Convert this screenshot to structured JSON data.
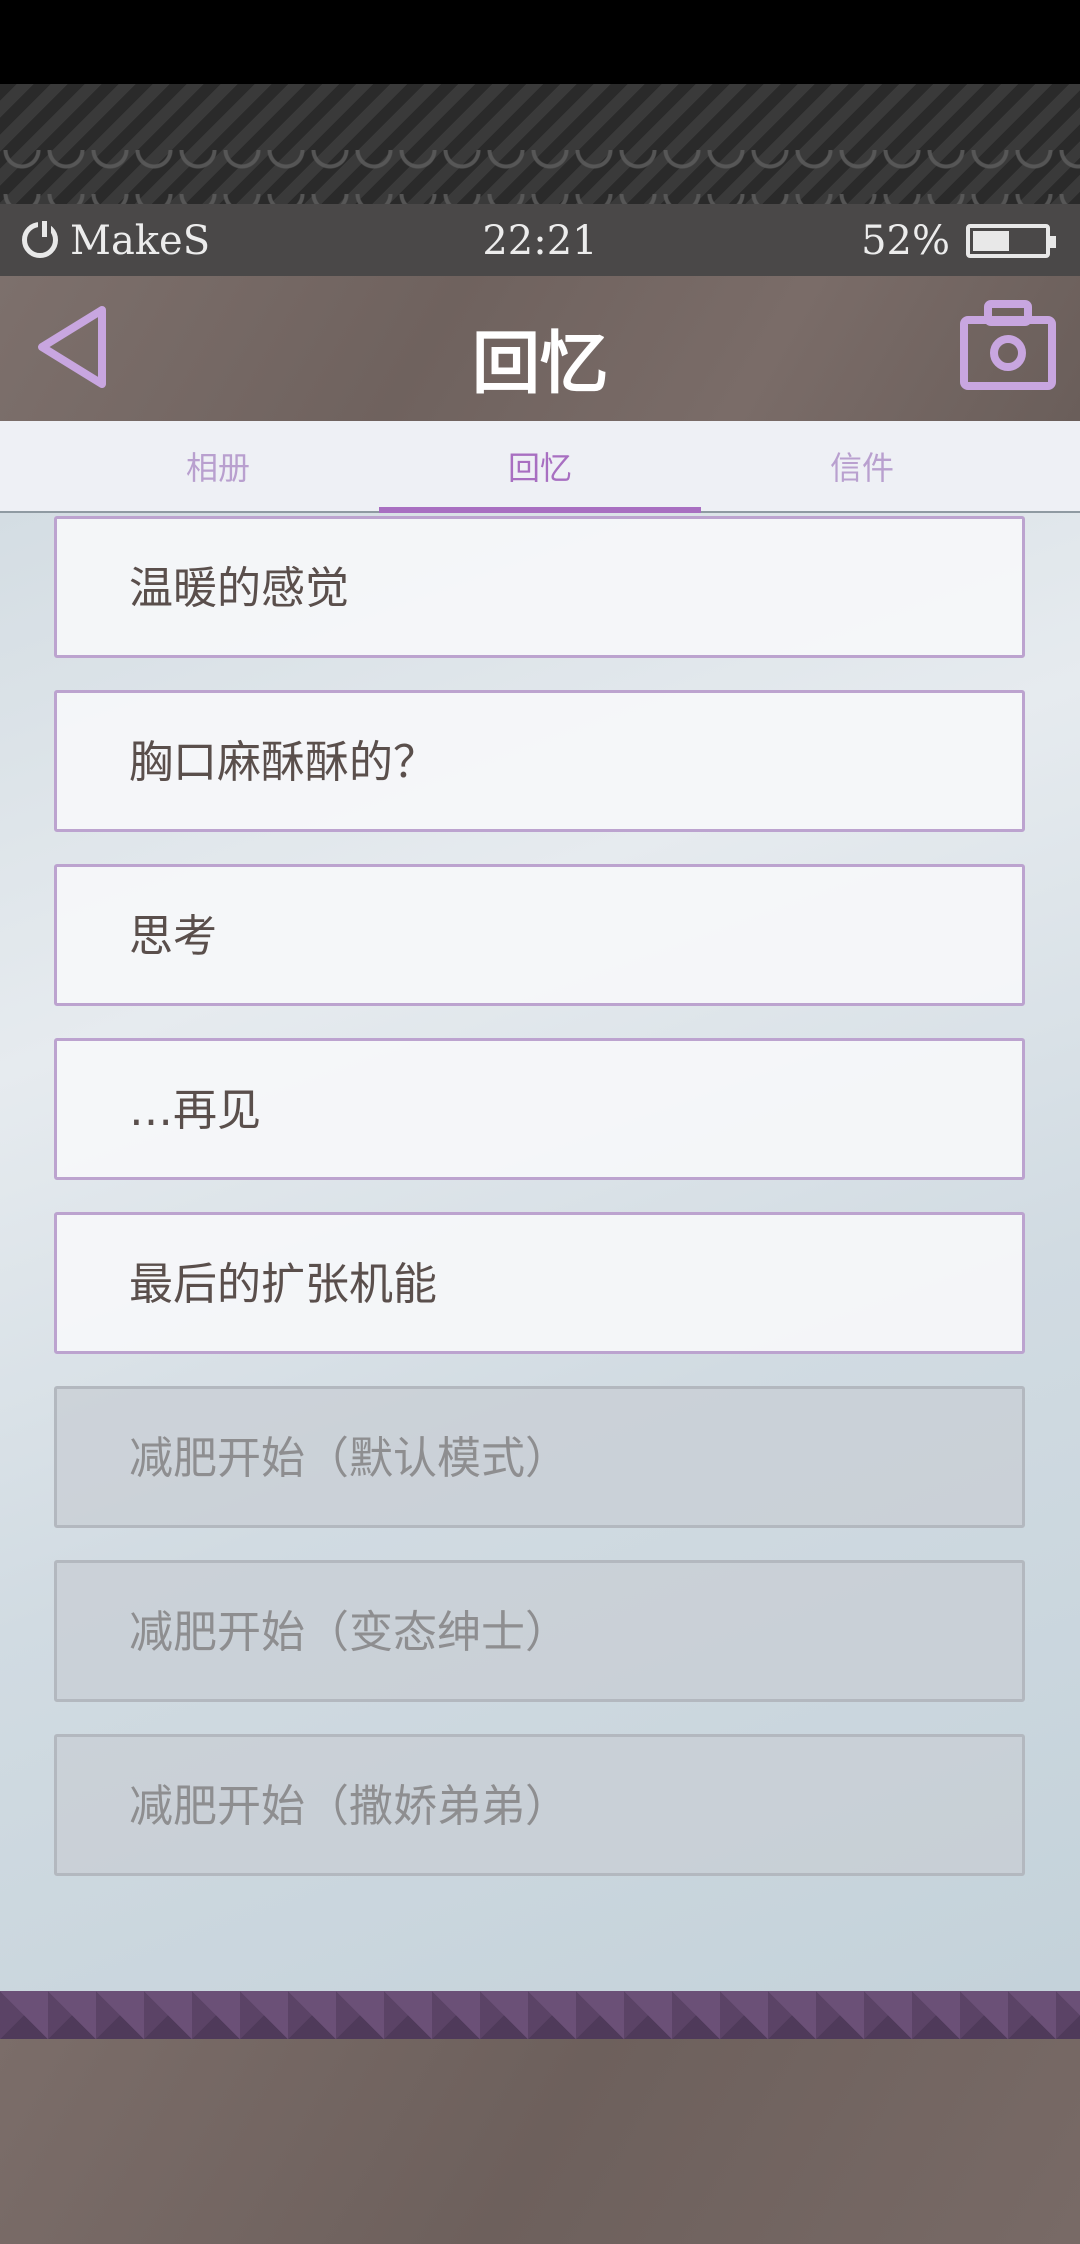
{
  "status_bar": {
    "carrier": "MakeS",
    "time": "22:21",
    "battery_percent": "52%",
    "battery_level": 0.52
  },
  "header": {
    "title": "回忆",
    "back_icon": "back-triangle-icon",
    "camera_icon": "camera-icon"
  },
  "tabs": [
    {
      "label": "相册",
      "active": false
    },
    {
      "label": "回忆",
      "active": true
    },
    {
      "label": "信件",
      "active": false
    }
  ],
  "memories": [
    {
      "label": "温暖的感觉",
      "unlocked": true
    },
    {
      "label": "胸口麻酥酥的？",
      "unlocked": true
    },
    {
      "label": "思考",
      "unlocked": true
    },
    {
      "label": "…再见",
      "unlocked": true
    },
    {
      "label": "最后的扩张机能",
      "unlocked": true
    },
    {
      "label": "减肥开始（默认模式）",
      "unlocked": false
    },
    {
      "label": "减肥开始（变态绅士）",
      "unlocked": false
    },
    {
      "label": "减肥开始（撒娇弟弟）",
      "unlocked": false
    }
  ],
  "colors": {
    "accent": "#a86fc1",
    "header_bg": "#776a66",
    "item_border": "#bca3cf"
  }
}
